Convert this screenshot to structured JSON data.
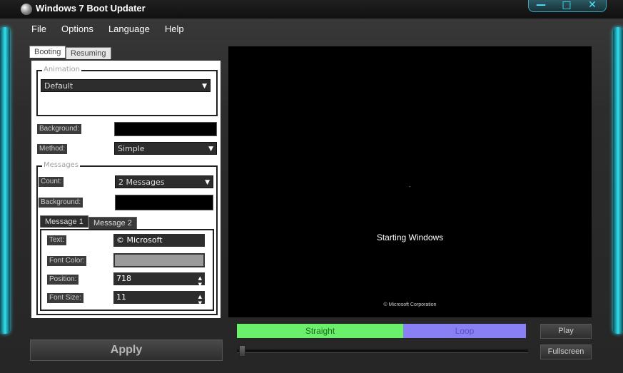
{
  "window": {
    "title": "Windows 7 Boot Updater",
    "controls": {
      "minimize": "—",
      "maximize": "□",
      "close": "✕"
    }
  },
  "menu": [
    "File",
    "Options",
    "Language",
    "Help"
  ],
  "tabs": {
    "booting": "Booting",
    "resuming": "Resuming"
  },
  "animation": {
    "legend": "Animation",
    "value": "Default"
  },
  "background": {
    "label": "Background:"
  },
  "method": {
    "label": "Method:",
    "value": "Simple"
  },
  "messages": {
    "legend": "Messages",
    "count_label": "Count:",
    "count_value": "2 Messages",
    "background_label": "Background:",
    "tabs": [
      "Message 1",
      "Message 2"
    ],
    "text_label": "Text:",
    "text_value": "© Microsoft Corporation",
    "font_color_label": "Font Color:",
    "position_label": "Position:",
    "position_value": "718",
    "font_size_label": "Font Size:",
    "font_size_value": "11"
  },
  "preview": {
    "main_text": "Starting Windows",
    "footer_text": "© Microsoft Corporation",
    "dot": "-"
  },
  "bars": {
    "straight": "Straight",
    "loop": "Loop"
  },
  "buttons": {
    "apply": "Apply",
    "play": "Play",
    "fullscreen": "Fullscreen"
  },
  "colors": {
    "straight": "#6bf06b",
    "loop": "#8a80f5",
    "accent": "#33e0f0"
  }
}
